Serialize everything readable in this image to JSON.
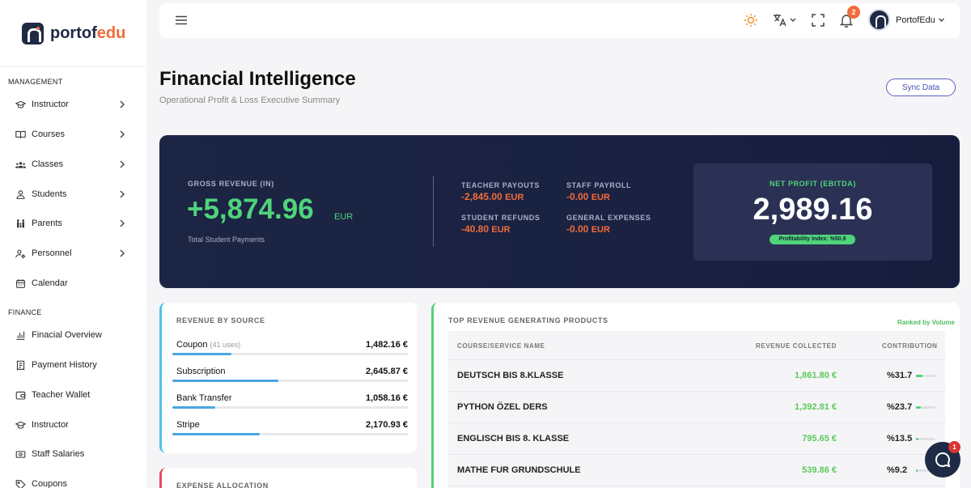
{
  "brand": {
    "name_main": "portof",
    "name_accent": "edu"
  },
  "sidebar": {
    "management_title": "MANAGEMENT",
    "management_items": [
      {
        "label": "Instructor",
        "icon": "graduation-cap-icon"
      },
      {
        "label": "Courses",
        "icon": "book-open-icon"
      },
      {
        "label": "Classes",
        "icon": "users-group-icon"
      },
      {
        "label": "Students",
        "icon": "user-icon"
      },
      {
        "label": "Parents",
        "icon": "family-icon"
      },
      {
        "label": "Personnel",
        "icon": "user-cog-icon"
      },
      {
        "label": "Calendar",
        "icon": "calendar-icon"
      }
    ],
    "finance_title": "FINANCE",
    "finance_items": [
      {
        "label": "Finacial Overview",
        "icon": "chart-bar-icon"
      },
      {
        "label": "Payment History",
        "icon": "receipt-icon"
      },
      {
        "label": "Teacher Wallet",
        "icon": "wallet-icon"
      },
      {
        "label": "Instructor",
        "icon": "graduation-cap-icon"
      },
      {
        "label": "Staff Salaries",
        "icon": "money-icon"
      },
      {
        "label": "Coupons",
        "icon": "tag-icon"
      }
    ]
  },
  "topbar": {
    "notification_count": "2",
    "user_name": "PortofEdu"
  },
  "page": {
    "title": "Financial Intelligence",
    "subtitle": "Operational Profit & Loss Executive Summary",
    "sync_label": "Sync Data"
  },
  "hero": {
    "gross_label": "GROSS REVENUE (IN)",
    "gross_value": "+5,874.96",
    "gross_currency": "EUR",
    "gross_sub": "Total Student Payments",
    "teacher_payouts_label": "TEACHER PAYOUTS",
    "teacher_payouts_value": "-2,845.00",
    "staff_payroll_label": "STAFF PAYROLL",
    "staff_payroll_value": "-0.00",
    "student_refunds_label": "STUDENT REFUNDS",
    "student_refunds_value": "-40.80",
    "general_expenses_label": "GENERAL EXPENSES",
    "general_expenses_value": "-0.00",
    "currency": "EUR",
    "net_label": "NET PROFIT (EBITDA)",
    "net_value": "2,989.16",
    "profitability": "Profitability Index: %50.9"
  },
  "revenue_by_source": {
    "title": "REVENUE BY SOURCE",
    "items": [
      {
        "name": "Coupon",
        "note": "(41 uses)",
        "value": "1,482.16 €",
        "share": 0.25
      },
      {
        "name": "Subscription",
        "note": "",
        "value": "2,645.87 €",
        "share": 0.45
      },
      {
        "name": "Bank Transfer",
        "note": "",
        "value": "1,058.16 €",
        "share": 0.18
      },
      {
        "name": "Stripe",
        "note": "",
        "value": "2,170.93 €",
        "share": 0.37
      }
    ]
  },
  "expense_allocation": {
    "title": "EXPENSE ALLOCATION"
  },
  "products": {
    "title": "TOP REVENUE GENERATING PRODUCTS",
    "ranked_label": "Ranked by Volume",
    "col_name": "COURSE/SERVICE NAME",
    "col_revenue": "REVENUE COLLECTED",
    "col_contribution": "CONTRIBUTION",
    "rows": [
      {
        "name": "DEUTSCH BIS 8.KLASSE",
        "revenue": "1,861.80 €",
        "pct": "%31.7",
        "share": 0.317
      },
      {
        "name": "PYTHON ÖZEL DERS",
        "revenue": "1,392.81 €",
        "pct": "%23.7",
        "share": 0.237
      },
      {
        "name": "ENGLISCH BIS 8. KLASSE",
        "revenue": "795.65 €",
        "pct": "%13.5",
        "share": 0.135
      },
      {
        "name": "MATHE FUR GRUNDSCHULE",
        "revenue": "539.86 €",
        "pct": "%9.2",
        "share": 0.092
      }
    ]
  },
  "chat": {
    "badge_count": "1"
  },
  "colors": {
    "accent": "#f26b3a",
    "navy": "#1c2544",
    "positive": "#4fd47a",
    "negative": "#f26b3a"
  }
}
